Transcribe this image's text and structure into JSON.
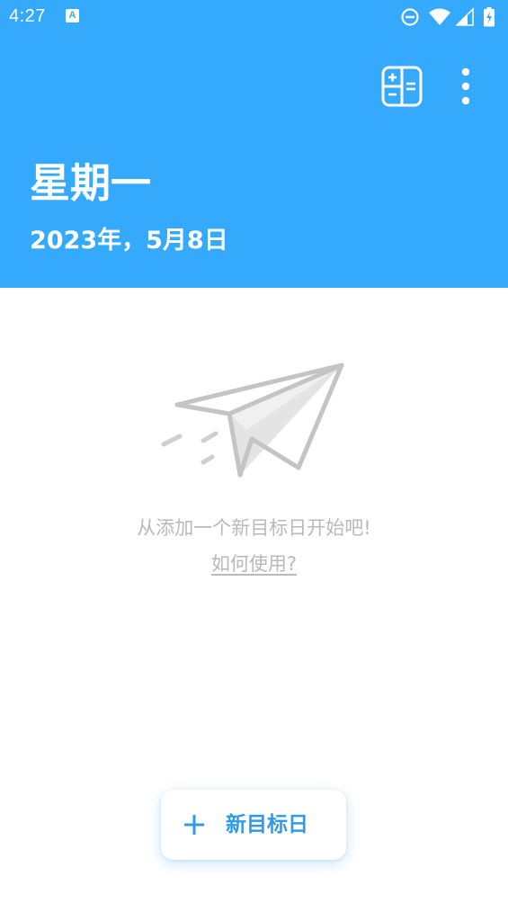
{
  "status_bar": {
    "time": "4:27",
    "notification_icon": "A",
    "icons": [
      "do-not-disturb-icon",
      "wifi-icon",
      "cell-signal-icon",
      "battery-charging-icon"
    ]
  },
  "toolbar": {
    "calculator_icon": "calculator-icon",
    "more_icon": "more-vert-icon"
  },
  "header": {
    "day": "星期一",
    "date": "2023年，5月8日"
  },
  "empty_state": {
    "illustration": "paper-plane-icon",
    "message": "从添加一个新目标日开始吧!",
    "help_link": "如何使用?"
  },
  "fab": {
    "icon": "plus-icon",
    "label": "新目标日"
  },
  "colors": {
    "header_bg": "#35a9fb",
    "accent": "#2f9be8",
    "muted_text": "#b9b9b9"
  }
}
